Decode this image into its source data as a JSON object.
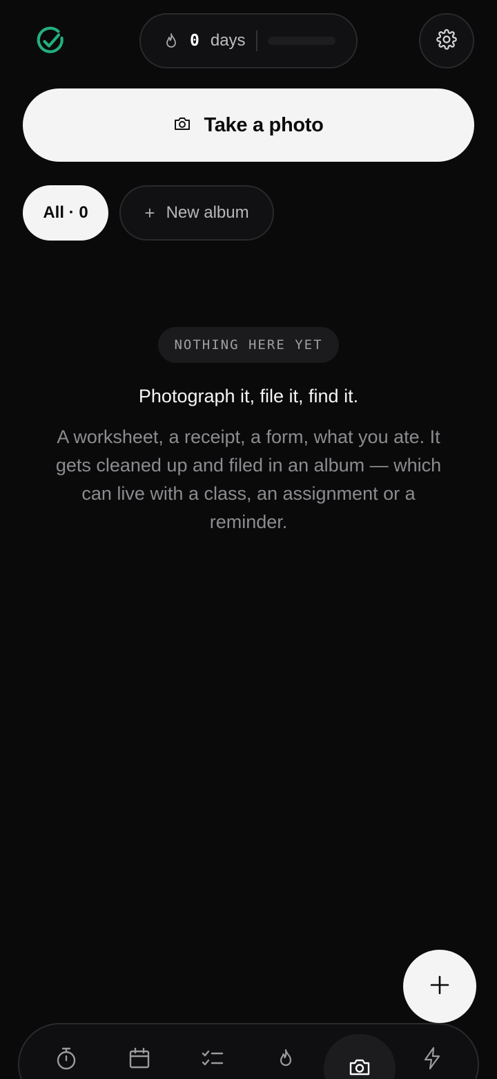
{
  "header": {
    "logo_icon": "check-circle-icon",
    "streak": {
      "icon": "flame-icon",
      "count": "0",
      "unit": "days",
      "progress": 0
    },
    "settings_icon": "gear-icon"
  },
  "actions": {
    "take_photo": {
      "icon": "camera-icon",
      "label": "Take a photo"
    }
  },
  "albums": {
    "all_label": "All · 0",
    "new_album_label": "New album"
  },
  "empty_state": {
    "badge": "NOTHING HERE YET",
    "title": "Photograph it, file it, find it.",
    "description": "A worksheet, a receipt, a form, what you ate. It gets cleaned up and filed in an album — which can live with a class, an assignment or a reminder."
  },
  "fab_icon": "plus-icon",
  "nav": {
    "items": [
      {
        "icon": "timer-icon"
      },
      {
        "icon": "calendar-icon"
      },
      {
        "icon": "checklist-icon"
      },
      {
        "icon": "flame-icon"
      },
      {
        "icon": "camera-icon",
        "active": true
      },
      {
        "icon": "lightning-icon"
      }
    ]
  },
  "colors": {
    "background": "#0a0a0b",
    "accent": "#22b07d",
    "surface": "#111113",
    "primary_button": "#f4f4f4"
  }
}
